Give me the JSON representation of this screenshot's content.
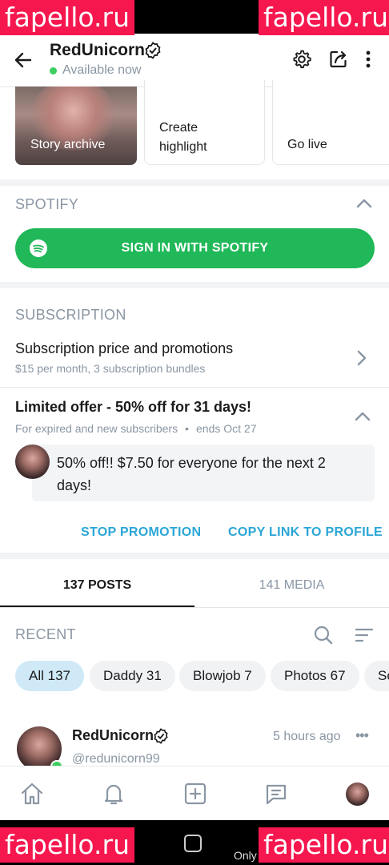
{
  "watermark": "fapello.ru",
  "header": {
    "name": "RedUnicorn",
    "status": "Available now"
  },
  "highlights": {
    "story_archive": "Story archive",
    "create_highlight": "Create\nhighlight",
    "go_live": "Go live"
  },
  "spotify": {
    "section_title": "SPOTIFY",
    "button_label": "SIGN IN WITH SPOTIFY"
  },
  "subscription": {
    "section_title": "SUBSCRIPTION",
    "price_title": "Subscription price and promotions",
    "price_subtitle": "$15 per month, 3 subscription bundles"
  },
  "offer": {
    "title": "Limited offer - 50% off for 31 days!",
    "subtitle": "For expired and new subscribers",
    "bullet": "•",
    "ends": "ends Oct 27",
    "message": "50% off!! $7.50 for everyone for the next 2 days!",
    "stop_label": "STOP PROMOTION",
    "copy_label": "COPY LINK TO PROFILE"
  },
  "tabs": {
    "posts": "137 POSTS",
    "media": "141 MEDIA"
  },
  "recent": {
    "title": "RECENT",
    "chips": [
      "All 137",
      "Daddy 31",
      "Blowjob 7",
      "Photos 67",
      "So"
    ]
  },
  "post": {
    "name": "RedUnicorn",
    "handle": "@redunicorn99",
    "time": "5 hours ago",
    "more": "•••"
  },
  "bottom_nav": {
    "only_text": "Only"
  },
  "colors": {
    "spotify_green": "#20b858",
    "accent_blue": "#2aa6d6",
    "online_green": "#3ccf5f",
    "watermark_red": "#f6174e"
  },
  "icons": [
    "back-arrow-icon",
    "verified-icon",
    "gear-icon",
    "share-icon",
    "more-vertical-icon",
    "spotify-icon",
    "chevron-up-icon",
    "chevron-right-icon",
    "search-icon",
    "sort-icon",
    "home-icon",
    "bell-icon",
    "plus-square-icon",
    "message-icon"
  ]
}
